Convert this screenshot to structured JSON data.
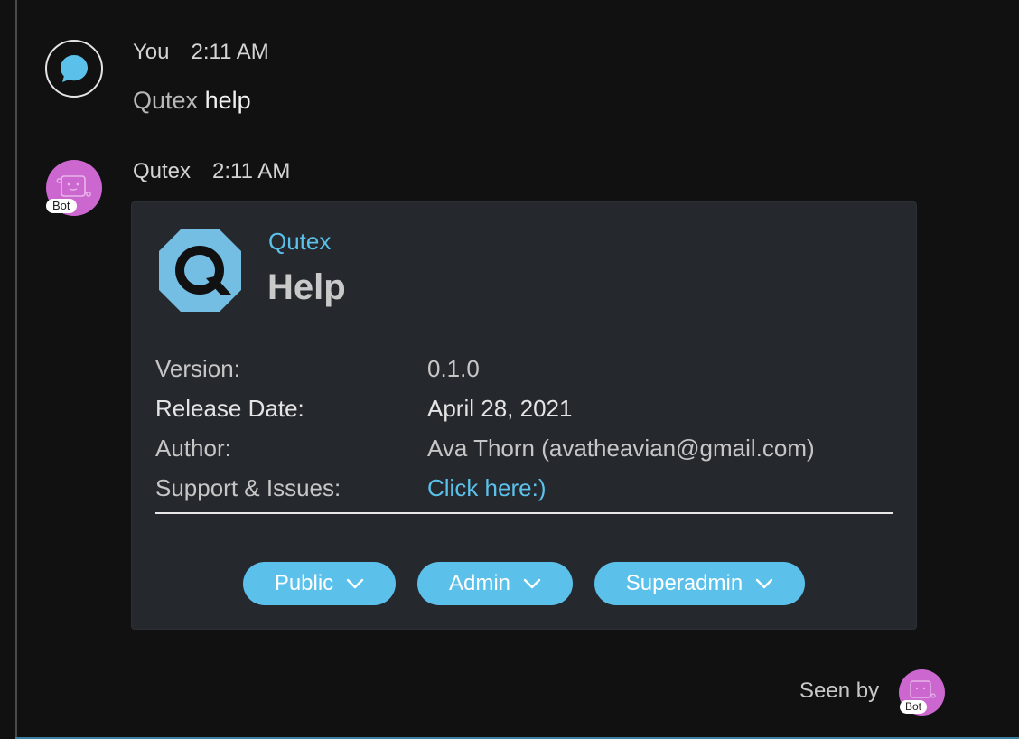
{
  "messages": [
    {
      "sender": "You",
      "time": "2:11 AM",
      "text_prefix": "Qutex",
      "text_command": "help",
      "avatar_icon": "chat-bubble-icon"
    },
    {
      "sender": "Qutex",
      "time": "2:11 AM",
      "avatar_icon": "robot-icon",
      "avatar_tag": "Bot",
      "card": {
        "logo_icon": "qutex-logo-icon",
        "subtitle": "Qutex",
        "title": "Help",
        "facts": [
          {
            "label": "Version:",
            "value": "0.1.0"
          },
          {
            "label": "Release Date:",
            "value": "April 28, 2021"
          },
          {
            "label": "Author:",
            "value": "Ava Thorn (avatheavian@gmail.com)"
          },
          {
            "label": "Support & Issues:",
            "value": "Click here:)"
          }
        ],
        "buttons": [
          {
            "label": "Public"
          },
          {
            "label": "Admin"
          },
          {
            "label": "Superadmin"
          }
        ]
      }
    }
  ],
  "seen_by": {
    "label": "Seen by",
    "avatar_tag": "Bot"
  },
  "colors": {
    "background": "#111112",
    "card": "#25282c",
    "accent": "#5bc0ea",
    "bot_avatar": "#cc67cf"
  }
}
